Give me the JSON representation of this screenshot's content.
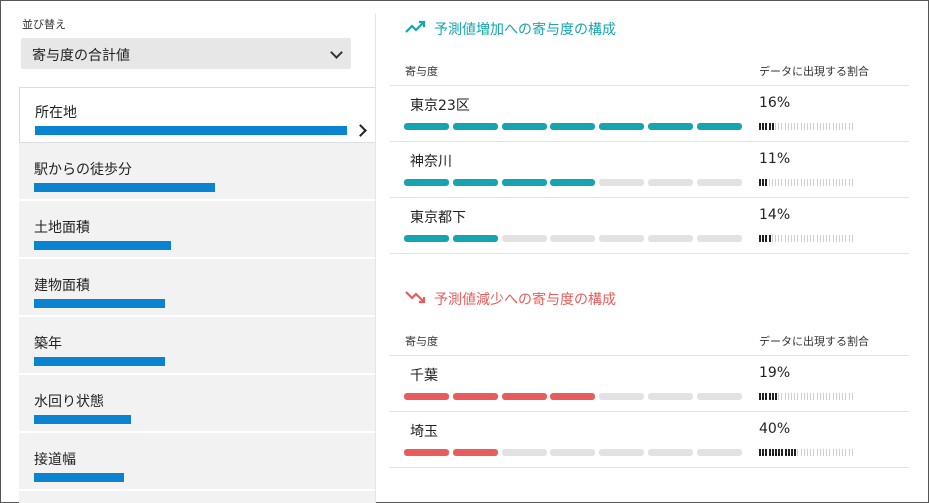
{
  "sort": {
    "label": "並び替え",
    "selected": "寄与度の合計値"
  },
  "features": [
    {
      "label": "所在地",
      "value": 1.0,
      "selected": true
    },
    {
      "label": "駅からの徒歩分",
      "value": 0.58
    },
    {
      "label": "土地面積",
      "value": 0.44
    },
    {
      "label": "建物面積",
      "value": 0.42
    },
    {
      "label": "築年",
      "value": 0.42
    },
    {
      "label": "水回り状態",
      "value": 0.31
    },
    {
      "label": "接道幅",
      "value": 0.29
    }
  ],
  "increase": {
    "title": "予測値増加への寄与度の構成",
    "col_contribution": "寄与度",
    "col_ratio": "データに出現する割合",
    "color": "#16a5b0",
    "rows": [
      {
        "name": "東京23区",
        "percent": "16%",
        "segments_filled": 7,
        "ratio": 0.16
      },
      {
        "name": "神奈川",
        "percent": "11%",
        "segments_filled": 4,
        "ratio": 0.11
      },
      {
        "name": "東京都下",
        "percent": "14%",
        "segments_filled": 2,
        "ratio": 0.14
      }
    ]
  },
  "decrease": {
    "title": "予測値減少への寄与度の構成",
    "col_contribution": "寄与度",
    "col_ratio": "データに出現する割合",
    "color": "#e85c5c",
    "rows": [
      {
        "name": "千葉",
        "percent": "19%",
        "segments_filled": 4,
        "ratio": 0.19
      },
      {
        "name": "埼玉",
        "percent": "40%",
        "segments_filled": 2,
        "ratio": 0.4
      }
    ]
  },
  "icons": {
    "increase": "trend-up-icon",
    "decrease": "trend-down-icon",
    "select": "chevron-down-icon",
    "selected_row": "chevron-right-icon"
  }
}
